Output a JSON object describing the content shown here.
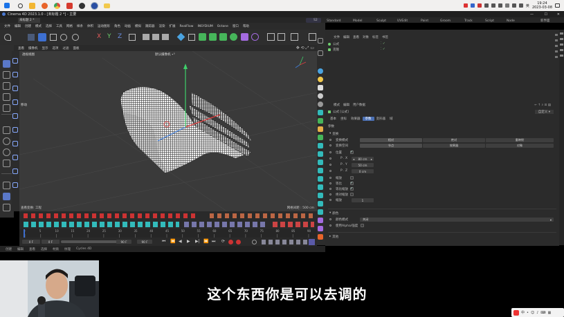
{
  "taskbar": {
    "search_icon": "search-icon",
    "clock_time": "19:24",
    "clock_date": "2023-03-08",
    "ime_label": "英",
    "app_icons": [
      {
        "name": "windows-start-icon",
        "color": "#1a73e8"
      },
      {
        "name": "search-icon",
        "color": "#333333"
      },
      {
        "name": "explorer-icon",
        "color": "#f2b632"
      },
      {
        "name": "firefox-icon",
        "color": "#e8642a"
      },
      {
        "name": "chrome-icon",
        "color": "#3ca85a"
      },
      {
        "name": "red-app-icon",
        "color": "#d63b2f"
      },
      {
        "name": "obs-icon",
        "color": "#333333"
      },
      {
        "name": "cinema4d-icon",
        "color": "#2a4fa3"
      },
      {
        "name": "folder-icon",
        "color": "#f2c94c"
      }
    ]
  },
  "window": {
    "title": "Cinema 4D 2023.1.0 - [未标题 2 *] - 主要",
    "doc_tab": "未标题 2 *",
    "controls": [
      "—",
      "☐",
      "✕"
    ]
  },
  "menubar": [
    "文件",
    "编辑",
    "创建",
    "模式",
    "选择",
    "工具",
    "网格",
    "样条",
    "体积",
    "运动图形",
    "角色",
    "动画",
    "模拟",
    "跟踪器",
    "渲染",
    "扩展",
    "RealFlow",
    "INSYDIUM",
    "Octane",
    "窗口",
    "帮助"
  ],
  "layouts": {
    "items": [
      "Standard",
      "Model",
      "Sculpt",
      "UVEdit",
      "Paint",
      "Groom",
      "Track",
      "Script",
      "Node",
      "新界面"
    ],
    "active_badge": "S2"
  },
  "viewport": {
    "menu": [
      "查看",
      "摄像机",
      "显示",
      "选项",
      "过滤",
      "面板"
    ],
    "view_name": "透视视图",
    "camera_label": "默认摄像机 ∙⁰",
    "left_label": "移动",
    "bottom_left": "查看变换: 工程",
    "bottom_right": "网格间距 : 500 cm"
  },
  "object_manager": {
    "menu": [
      "文件",
      "编辑",
      "查看",
      "对象",
      "标签",
      "书签"
    ],
    "objects": [
      {
        "name": "公式",
        "color": "#6fcf6f"
      },
      {
        "name": "克隆",
        "color": "#6fcf6f"
      }
    ]
  },
  "attribute_manager": {
    "menu": [
      "模式",
      "编辑",
      "用户数据"
    ],
    "object_name": "公式 [公式]",
    "dropdown": "自定义",
    "tabs": [
      "基本",
      "坐标",
      "效果器",
      "参数",
      "变形器",
      "域"
    ],
    "active_tab": "参数",
    "section_params": "参数",
    "group_transform": "变换",
    "transform_mode_label": "变换模式",
    "transform_mode_options": [
      "相对",
      "绝对",
      "重映射"
    ],
    "transform_space_label": "变换空间",
    "transform_space_options": [
      "节点",
      "效果器",
      "对象"
    ],
    "position_label": "位置",
    "px_label": "P . X",
    "px_value": "80 cm",
    "py_label": "P . Y",
    "py_value": "50 cm",
    "pz_label": "P . Z",
    "pz_value": "0 cm",
    "scale_label": "缩放",
    "equal_scale_label": "等比",
    "equal_scale2_label": "等比缩放",
    "absolute_scale_label": "绝对缩放",
    "scale_value_label": "缩放",
    "scale_value": "1",
    "group_color": "颜色",
    "color_mode_label": "颜色模式",
    "color_mode_value": "关闭",
    "use_alpha_label": "使用Alpha/强度",
    "group_other": "其他"
  },
  "timeline": {
    "ticks": [
      "0",
      "5",
      "10",
      "15",
      "20",
      "25",
      "30",
      "35",
      "40",
      "45",
      "50",
      "55",
      "60",
      "65",
      "70",
      "75",
      "80",
      "85",
      "90"
    ],
    "current_frame": "0 F",
    "start_frame": "0 F",
    "end_frame": "90 F",
    "end_frame2": "90 F",
    "frame_box": "0 F"
  },
  "statusbar": [
    "创建",
    "编辑",
    "查看",
    "选择",
    "材质",
    "纹理",
    "Cycles 4D"
  ],
  "subtitle": "这个东西你是可以去调的",
  "colors": {
    "accent": "#2a6fd0",
    "active_tab": "#4a6fb3",
    "viewport_bg": "#3a3a3a",
    "panel_bg": "#2b2b2b"
  }
}
